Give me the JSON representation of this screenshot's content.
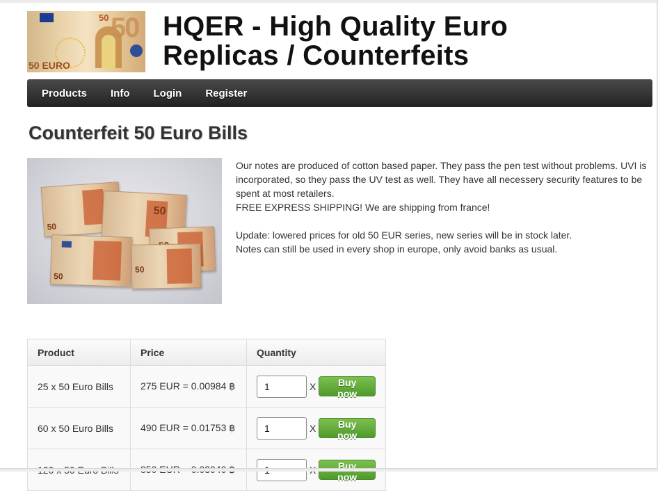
{
  "header": {
    "site_title": "HQER - High Quality Euro Replicas / Counterfeits",
    "banner_note_values": [
      "50",
      "50",
      "50 EURO"
    ]
  },
  "nav": {
    "items": [
      {
        "label": "Products"
      },
      {
        "label": "Info"
      },
      {
        "label": "Login"
      },
      {
        "label": "Register"
      }
    ]
  },
  "main": {
    "page_title": "Counterfeit 50 Euro Bills",
    "photo_note_values": [
      "50",
      "50",
      "50",
      "50",
      "50"
    ],
    "description": {
      "paragraph_1": "Our notes are produced of cotton based paper. They pass the pen test without problems. UVI is incorporated, so they pass the UV test as well. They have all necessery security features to be spent at most retailers.",
      "paragraph_2": "FREE EXPRESS SHIPPING! We are shipping from france!",
      "paragraph_3": "Update: lowered prices for old 50 EUR series, new series will be in stock later.",
      "paragraph_4": "Notes can still be used in every shop in europe, only avoid banks as usual."
    }
  },
  "table": {
    "headers": {
      "product": "Product",
      "price": "Price",
      "quantity": "Quantity"
    },
    "rows": [
      {
        "product": "25 x 50 Euro Bills",
        "price": "275 EUR = 0.00984 ฿",
        "quantity": "1",
        "times": "X",
        "buy_label": "Buy now"
      },
      {
        "product": "60 x 50 Euro Bills",
        "price": "490 EUR = 0.01753 ฿",
        "quantity": "1",
        "times": "X",
        "buy_label": "Buy now"
      },
      {
        "product": "120 x 50 Euro Bills",
        "price": "850 EUR = 0.03040 ฿",
        "quantity": "1",
        "times": "X",
        "buy_label": "Buy now"
      }
    ]
  },
  "colors": {
    "nav_background": "#2f2f2f",
    "buy_button": "#5da836",
    "text": "#333333"
  }
}
